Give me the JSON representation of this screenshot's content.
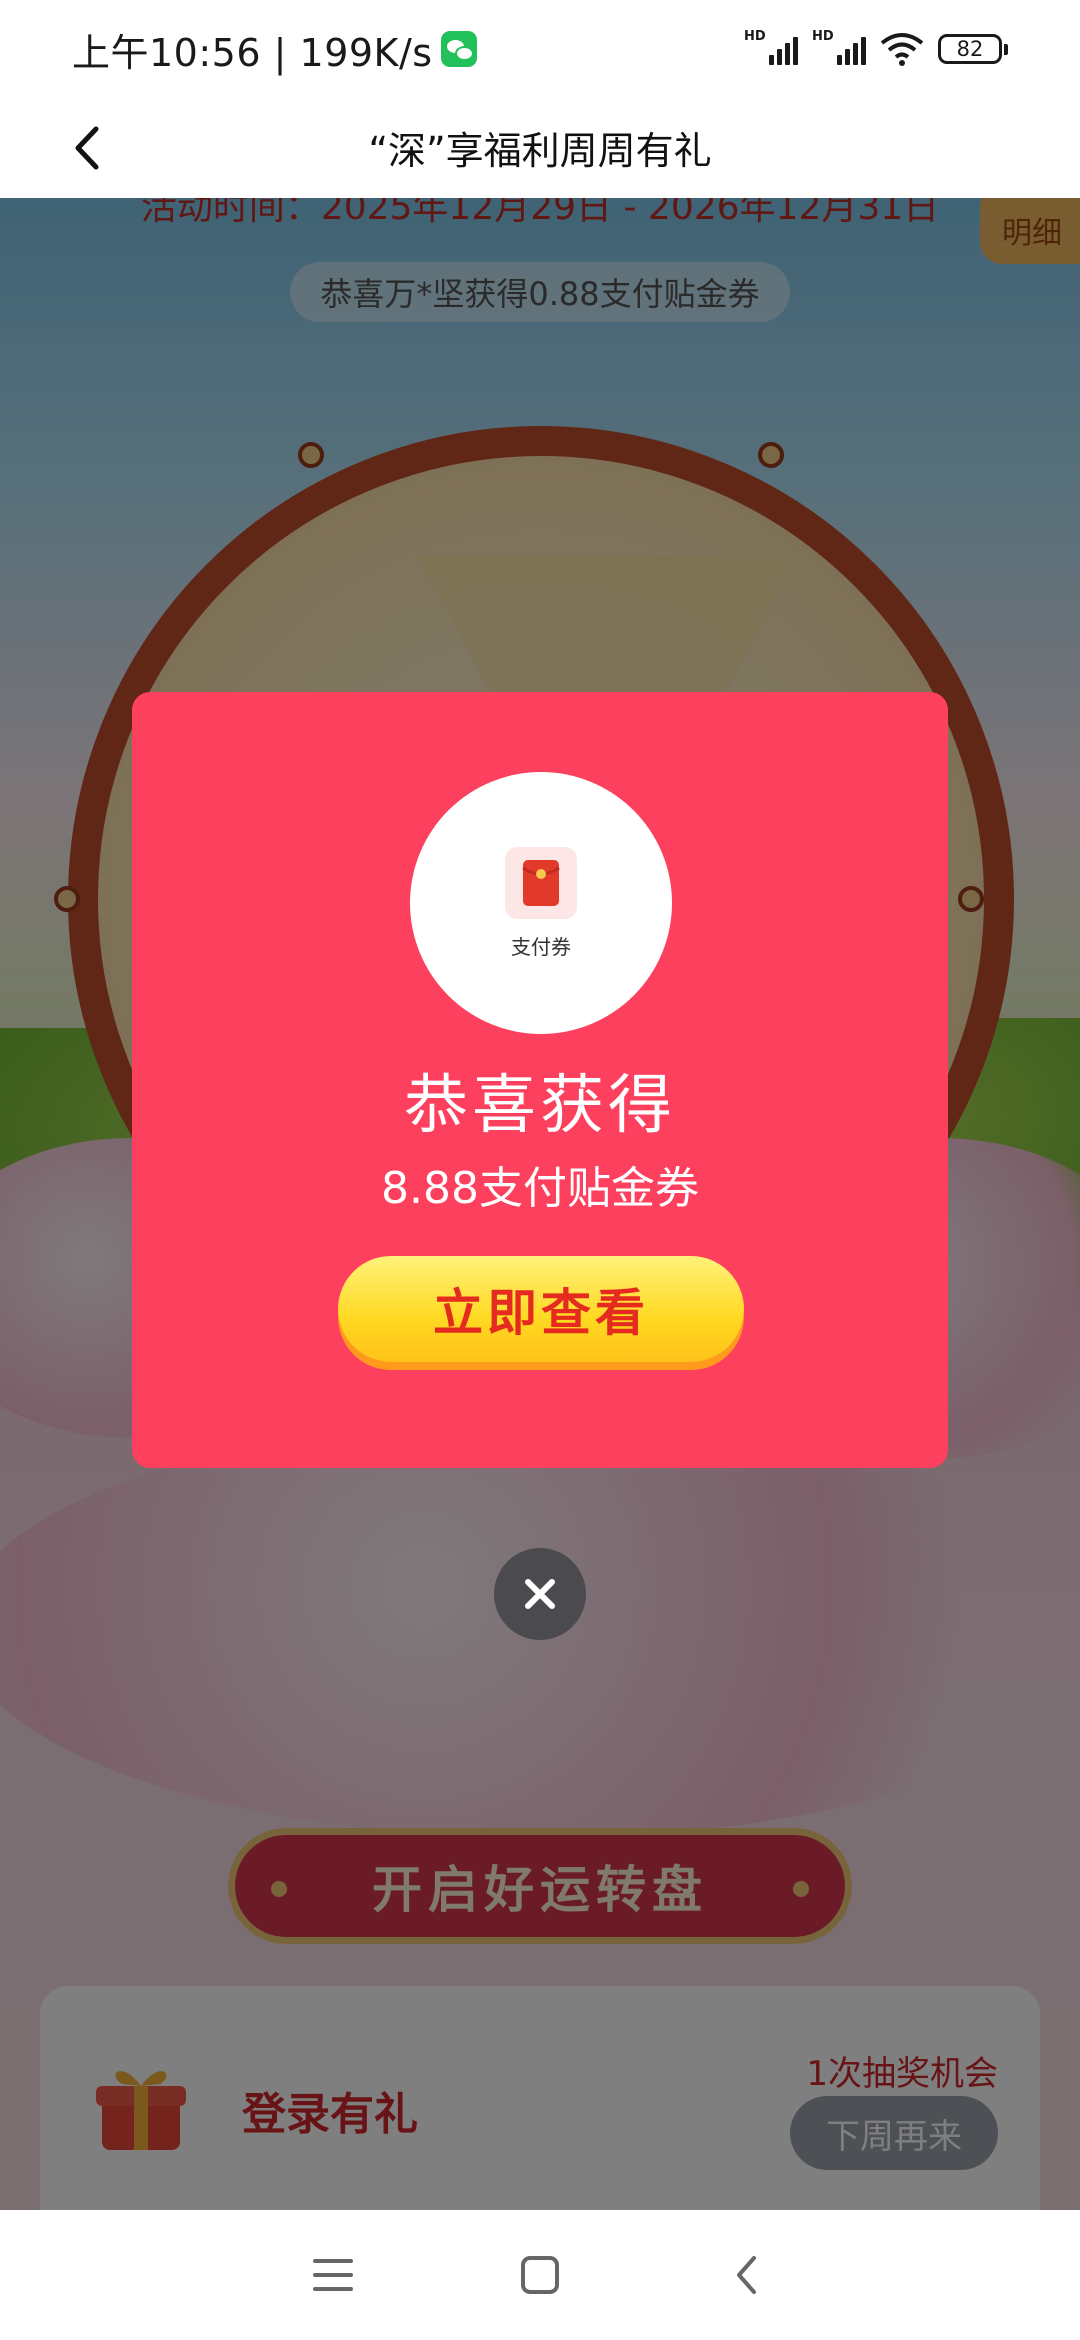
{
  "status_bar": {
    "time": "上午10:56",
    "separator": "|",
    "speed": "199K/s",
    "network_1": "HD",
    "network_2": "HD",
    "battery": "82"
  },
  "nav": {
    "title": "“深”享福利周周有礼"
  },
  "page": {
    "activity_time": "活动时间：2025年12月29日 - 2026年12月31日",
    "detail_tab": "明细",
    "ticker": "恭喜万*坚获得0.88支付贴金券",
    "start_button": "开启好运转盘"
  },
  "task": {
    "label": "登录有礼",
    "chances": "1次抽奖机会",
    "button": "下周再来"
  },
  "modal": {
    "coupon_label": "支付券",
    "title": "恭喜获得",
    "prize": "8.88支付贴金券",
    "view_button": "立即查看"
  },
  "icons": {
    "back": "chevron-left-icon",
    "close": "close-icon",
    "coupon": "red-envelope-icon",
    "gift": "gift-box-icon",
    "menu": "menu-icon",
    "home": "home-icon",
    "system_back": "back-icon"
  },
  "colors": {
    "modal_bg": "#fd405d",
    "button_yellow": "#ffd820",
    "task_red": "#d0292f",
    "wheel_rim": "#c04c2d"
  }
}
